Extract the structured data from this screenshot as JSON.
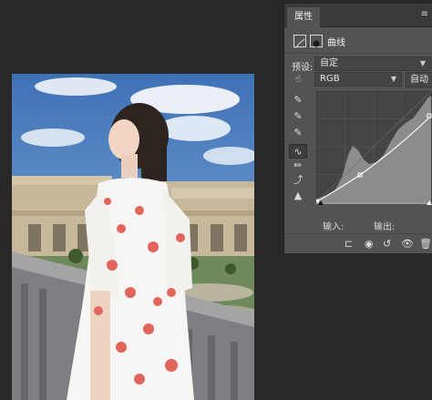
{
  "panel": {
    "tab_label": "属性",
    "adjustment_name": "曲线",
    "preset_label": "预设:",
    "preset_value": "自定",
    "channel_value": "RGB",
    "auto_label": "自动",
    "input_label": "输入:",
    "output_label": "输出:"
  },
  "icons": {
    "panel_menu": "menu-icon",
    "tools": [
      "hand-target-icon",
      "eyedropper-black-icon",
      "eyedropper-gray-icon",
      "eyedropper-white-icon",
      "curve-edit-icon",
      "pencil-icon",
      "smooth-icon",
      "clipping-warning-icon"
    ],
    "footer": [
      "clip-to-layer-icon",
      "view-previous-icon",
      "reset-icon",
      "visibility-icon",
      "delete-icon"
    ]
  },
  "colors": {
    "app_bg": "#282828",
    "panel_bg": "#535353",
    "graph_bg": "#444444",
    "curve": "#ffffff",
    "histogram": "#8c8c8c"
  }
}
